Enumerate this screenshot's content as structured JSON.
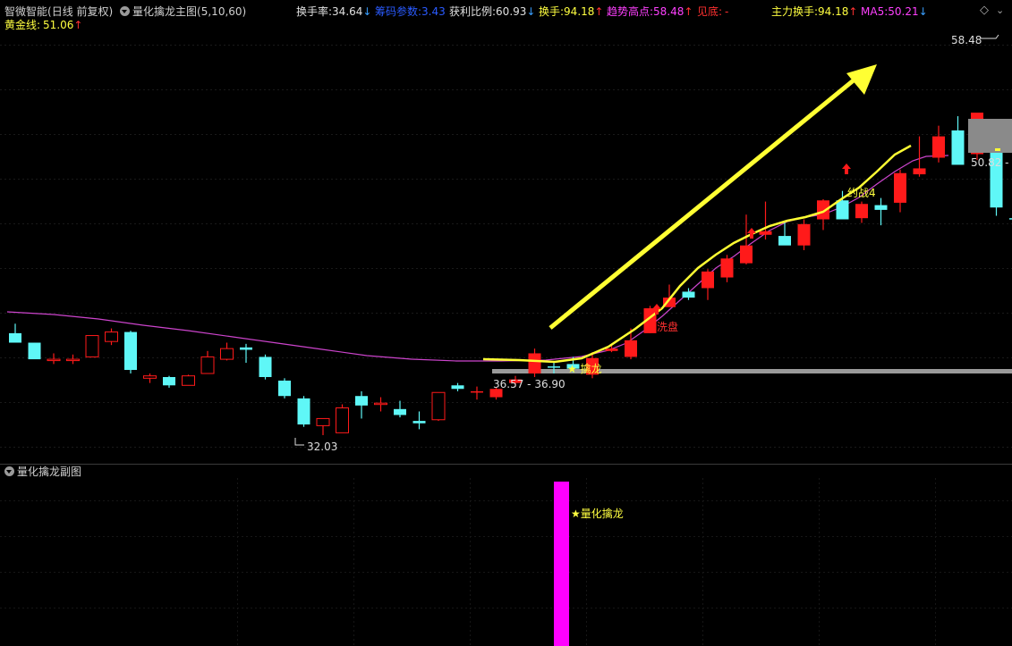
{
  "header": {
    "stock_name": "智微智能",
    "period": "(日线 前复权)",
    "indicator_name": "量化擒龙主图",
    "indicator_params": "(5,10,60)",
    "turnover": {
      "label": "换手率:",
      "value": "34.64",
      "arrow": "↓"
    },
    "chip": {
      "label": "筹码参数:",
      "value": "3.43"
    },
    "profit": {
      "label": "获利比例:",
      "value": "60.93",
      "arrow": "↓"
    },
    "hand": {
      "label": "换手:",
      "value": "94.18",
      "arrow": "↑"
    },
    "trend_high": {
      "label": "趋势高点:",
      "value": "58.48",
      "arrow": "↑"
    },
    "bottom": {
      "label": "见底:",
      "value": "-"
    },
    "main_hand": {
      "label": "主力换手:",
      "value": "94.18",
      "arrow": "↑"
    },
    "ma5": {
      "label": "MA5:",
      "value": "50.21",
      "arrow": "↓"
    },
    "gold_line": {
      "label": "黄金线:",
      "value": "51.06",
      "arrow": "↑"
    }
  },
  "annotations": {
    "high_price": "58.48",
    "low_price": "32.03",
    "gray_value": "50.82 - 5",
    "range_label": "36.57 - 36.90",
    "qinlong": "★ 擒龙",
    "xipan": "洗盘",
    "label4": "约战4"
  },
  "sub_panel": {
    "title": "量化擒龙副图",
    "signal_label": "★量化擒龙"
  },
  "colors": {
    "up": "#ff1a1a",
    "down": "#5ff7f7",
    "ma_gold": "#ffff33",
    "ma_long": "#cc44cc",
    "signal_bar": "#ff00ff"
  },
  "chart_data": {
    "type": "candlestick",
    "candles": [
      [
        35.2,
        36.0,
        34.6,
        34.4
      ],
      [
        34.4,
        34.4,
        33.2,
        33.0
      ],
      [
        32.9,
        33.5,
        32.6,
        33.0
      ],
      [
        32.9,
        33.4,
        32.6,
        33.0
      ],
      [
        33.2,
        35.0,
        33.2,
        35.0
      ],
      [
        34.5,
        35.6,
        34.2,
        35.3
      ],
      [
        35.3,
        35.4,
        31.8,
        32.1
      ],
      [
        31.4,
        31.8,
        31.0,
        31.6
      ],
      [
        31.5,
        31.6,
        30.6,
        30.8
      ],
      [
        30.8,
        31.7,
        30.8,
        31.6
      ],
      [
        31.8,
        33.7,
        31.8,
        33.2
      ],
      [
        33.0,
        34.4,
        32.9,
        33.9
      ],
      [
        34.0,
        34.3,
        32.7,
        33.8
      ],
      [
        33.2,
        33.4,
        31.3,
        31.5
      ],
      [
        31.2,
        31.4,
        29.7,
        29.9
      ],
      [
        29.7,
        29.9,
        27.3,
        27.5
      ],
      [
        27.4,
        28.0,
        26.6,
        28.0
      ],
      [
        26.8,
        29.2,
        26.8,
        28.9
      ],
      [
        29.9,
        30.3,
        28.0,
        29.1
      ],
      [
        29.2,
        29.8,
        28.6,
        29.3
      ],
      [
        28.8,
        29.5,
        28.1,
        28.3
      ],
      [
        27.8,
        28.6,
        27.1,
        27.6
      ],
      [
        27.9,
        30.2,
        27.8,
        30.2
      ],
      [
        30.8,
        31.0,
        30.3,
        30.5
      ],
      [
        30.3,
        30.7,
        29.6,
        30.3
      ],
      [
        29.8,
        30.6,
        29.6,
        30.5
      ],
      [
        31.0,
        31.6,
        30.7,
        31.3
      ],
      [
        31.8,
        33.9,
        31.5,
        33.5
      ],
      [
        32.4,
        32.7,
        31.8,
        32.3
      ],
      [
        32.6,
        33.2,
        31.9,
        32.2
      ],
      [
        31.7,
        33.6,
        31.4,
        33.1
      ],
      [
        33.7,
        34.2,
        33.6,
        33.9
      ],
      [
        33.2,
        35.6,
        33.0,
        34.6
      ],
      [
        35.2,
        37.5,
        35.2,
        37.3
      ],
      [
        37.4,
        39.3,
        37.4,
        38.2
      ],
      [
        38.7,
        39.0,
        38.0,
        38.2
      ],
      [
        39.0,
        40.6,
        38.0,
        40.4
      ],
      [
        39.9,
        41.8,
        39.5,
        41.5
      ],
      [
        41.1,
        45.2,
        41.0,
        42.6
      ],
      [
        43.5,
        46.3,
        43.1,
        43.8
      ],
      [
        43.4,
        44.6,
        43.0,
        42.6
      ],
      [
        42.6,
        44.8,
        42.2,
        44.4
      ],
      [
        44.8,
        46.5,
        43.9,
        46.4
      ],
      [
        46.4,
        47.2,
        45.8,
        44.8
      ],
      [
        44.9,
        46.3,
        44.5,
        46.1
      ],
      [
        46.0,
        46.6,
        44.3,
        45.6
      ],
      [
        46.2,
        49.0,
        45.4,
        48.7
      ],
      [
        48.6,
        51.8,
        48.4,
        49.1
      ],
      [
        50.0,
        52.7,
        49.6,
        51.8
      ],
      [
        52.3,
        53.5,
        49.6,
        49.4
      ],
      [
        50.3,
        53.6,
        49.8,
        53.8
      ],
      [
        51.5,
        50.5,
        45.1,
        45.8
      ],
      [
        44.9,
        44.9,
        43.8,
        44.8
      ],
      [
        48.6,
        48.6,
        43.5,
        43.3
      ],
      [
        51.5,
        54.6,
        51.5,
        56.4
      ],
      [
        57.4,
        58.5,
        54.6,
        54.6
      ]
    ]
  }
}
